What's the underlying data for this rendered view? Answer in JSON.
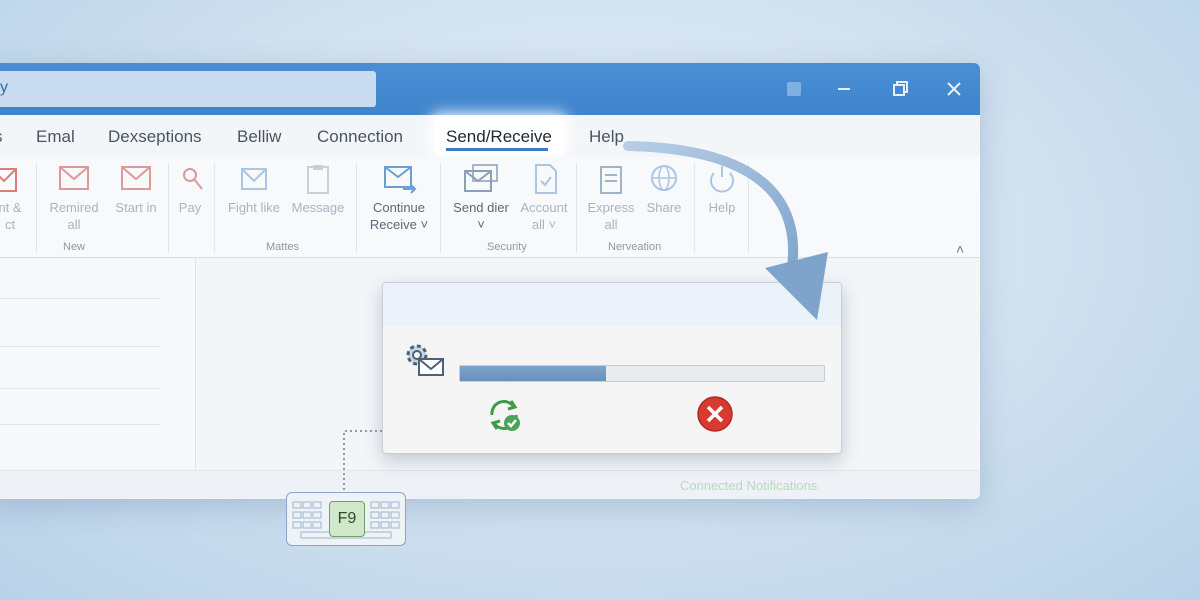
{
  "window": {
    "title_field": "y",
    "controls": [
      "app-icon",
      "minimize",
      "maximize",
      "close"
    ]
  },
  "tabs": [
    {
      "label": "s"
    },
    {
      "label": "Emal"
    },
    {
      "label": "Dexseptions"
    },
    {
      "label": "Belliw"
    },
    {
      "label": "Connection"
    },
    {
      "label": "Send/Receive",
      "active": true
    },
    {
      "label": "Help"
    }
  ],
  "ribbon": {
    "buttons": [
      {
        "line1": "nt &",
        "line2": "ct"
      },
      {
        "line1": "Remired",
        "line2": "all"
      },
      {
        "line1": "Start in",
        "line2": ""
      },
      {
        "line1": "Pay",
        "line2": ""
      },
      {
        "line1": "Fight like",
        "line2": ""
      },
      {
        "line1": "Message",
        "line2": ""
      },
      {
        "line1": "Continue",
        "line2": "Receive ˅"
      },
      {
        "line1": "Send dier",
        "line2": "˅"
      },
      {
        "line1": "Account",
        "line2": "all ˅"
      },
      {
        "line1": "Express",
        "line2": "all"
      },
      {
        "line1": "Share",
        "line2": ""
      },
      {
        "line1": "Help",
        "line2": ""
      }
    ],
    "groups": [
      "New",
      "Mattes",
      "Security",
      "Nerveation"
    ],
    "collapse_glyph": "˄"
  },
  "status": {
    "text": "Connected Notifications"
  },
  "dialog": {
    "progress": 0.4,
    "sync_icon": "sync-check-icon",
    "cancel_icon": "cancel-x-icon"
  },
  "keyboard": {
    "key": "F9"
  },
  "colors": {
    "titlebar": "#4a8fd4",
    "accent": "#3d7bc4",
    "progress": "#7499c2",
    "cancel": "#d83a32",
    "sync": "#3f9a4a"
  }
}
